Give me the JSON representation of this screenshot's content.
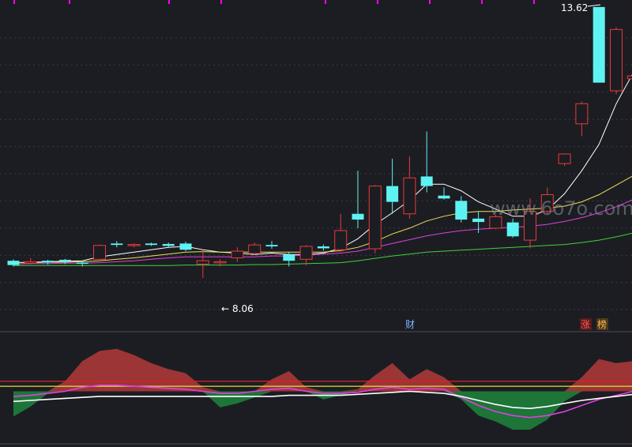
{
  "colors": {
    "background": "#1c1d22",
    "grid": "#3a3c44",
    "up": "#e83a3a",
    "down": "#5ef3f3",
    "ma5": "#ffffff",
    "ma10": "#f0e05a",
    "ma20": "#e040e0",
    "ma60": "#40d040",
    "indicator_up_fill": "#b23a3a",
    "indicator_down_fill": "#1e7a3a",
    "indicator_line_a": "#e040e0",
    "indicator_line_b": "#ffffff",
    "indicator_level_red": "#e02020",
    "indicator_level_yellow": "#e0e040",
    "markers": "#ff00ff",
    "watermark": "#8a8f9a"
  },
  "labels": {
    "high_value": "13.62",
    "low_value": "8.06",
    "low_arrow": "←",
    "event_cai": "财",
    "event_zhang": "涨",
    "event_bang": "榜",
    "watermark": "www.6o7o.com"
  },
  "chart_data": [
    {
      "type": "candlestick",
      "title": "",
      "xlabel": "",
      "ylabel": "",
      "ylim": [
        7.4,
        13.8
      ],
      "grid": true,
      "annotations": [
        {
          "text": "13.62",
          "at_index": 31,
          "kind": "high"
        },
        {
          "text": "8.06",
          "at_index": 11,
          "kind": "low"
        }
      ],
      "candles": [
        {
          "o": 8.42,
          "h": 8.45,
          "l": 8.3,
          "c": 8.33
        },
        {
          "o": 8.37,
          "h": 8.48,
          "l": 8.34,
          "c": 8.4
        },
        {
          "o": 8.42,
          "h": 8.44,
          "l": 8.34,
          "c": 8.38
        },
        {
          "o": 8.44,
          "h": 8.46,
          "l": 8.35,
          "c": 8.4
        },
        {
          "o": 8.38,
          "h": 8.4,
          "l": 8.3,
          "c": 8.37
        },
        {
          "o": 8.45,
          "h": 8.76,
          "l": 8.43,
          "c": 8.74
        },
        {
          "o": 8.78,
          "h": 8.83,
          "l": 8.7,
          "c": 8.75
        },
        {
          "o": 8.74,
          "h": 8.78,
          "l": 8.7,
          "c": 8.76
        },
        {
          "o": 8.78,
          "h": 8.8,
          "l": 8.73,
          "c": 8.75
        },
        {
          "o": 8.77,
          "h": 8.8,
          "l": 8.7,
          "c": 8.73
        },
        {
          "o": 8.78,
          "h": 8.82,
          "l": 8.62,
          "c": 8.65
        },
        {
          "o": 8.35,
          "h": 8.64,
          "l": 8.06,
          "c": 8.42
        },
        {
          "o": 8.38,
          "h": 8.45,
          "l": 8.3,
          "c": 8.4
        },
        {
          "o": 8.48,
          "h": 8.7,
          "l": 8.4,
          "c": 8.62
        },
        {
          "o": 8.57,
          "h": 8.8,
          "l": 8.55,
          "c": 8.75
        },
        {
          "o": 8.75,
          "h": 8.83,
          "l": 8.67,
          "c": 8.72
        },
        {
          "o": 8.55,
          "h": 8.6,
          "l": 8.3,
          "c": 8.42
        },
        {
          "o": 8.45,
          "h": 8.75,
          "l": 8.32,
          "c": 8.72
        },
        {
          "o": 8.72,
          "h": 8.76,
          "l": 8.63,
          "c": 8.68
        },
        {
          "o": 8.65,
          "h": 9.4,
          "l": 8.6,
          "c": 9.05
        },
        {
          "o": 9.4,
          "h": 10.3,
          "l": 9.1,
          "c": 9.28
        },
        {
          "o": 8.67,
          "h": 10.0,
          "l": 8.58,
          "c": 9.98
        },
        {
          "o": 9.98,
          "h": 10.55,
          "l": 9.4,
          "c": 9.65
        },
        {
          "o": 9.4,
          "h": 10.6,
          "l": 9.3,
          "c": 10.15
        },
        {
          "o": 10.18,
          "h": 11.12,
          "l": 9.85,
          "c": 9.98
        },
        {
          "o": 9.78,
          "h": 9.95,
          "l": 9.7,
          "c": 9.72
        },
        {
          "o": 9.67,
          "h": 9.77,
          "l": 9.22,
          "c": 9.28
        },
        {
          "o": 9.3,
          "h": 9.45,
          "l": 9.0,
          "c": 9.23
        },
        {
          "o": 9.1,
          "h": 9.38,
          "l": 9.08,
          "c": 9.34
        },
        {
          "o": 9.22,
          "h": 9.3,
          "l": 8.9,
          "c": 8.93
        },
        {
          "o": 8.85,
          "h": 9.72,
          "l": 8.68,
          "c": 9.45
        },
        {
          "o": 9.45,
          "h": 9.95,
          "l": 9.4,
          "c": 9.8
        },
        {
          "o": 10.45,
          "h": 10.66,
          "l": 10.4,
          "c": 10.65
        },
        {
          "o": 11.28,
          "h": 11.75,
          "l": 11.02,
          "c": 11.7
        },
        {
          "o": 13.72,
          "h": 13.72,
          "l": 12.14,
          "c": 12.14
        },
        {
          "o": 11.97,
          "h": 13.3,
          "l": 11.9,
          "c": 13.25
        },
        {
          "o": 12.22,
          "h": 12.3,
          "l": 12.0,
          "c": 12.28
        }
      ],
      "series": [
        {
          "name": "",
          "key": "ma5",
          "values": [
            8.38,
            8.39,
            8.4,
            8.41,
            8.42,
            8.5,
            8.55,
            8.6,
            8.65,
            8.7,
            8.72,
            8.65,
            8.6,
            8.58,
            8.55,
            8.58,
            8.55,
            8.55,
            8.58,
            8.68,
            8.88,
            9.18,
            9.42,
            9.68,
            10.02,
            10.02,
            9.88,
            9.65,
            9.5,
            9.35,
            9.35,
            9.48,
            9.82,
            10.3,
            10.85,
            11.7,
            12.35
          ]
        },
        {
          "name": "",
          "key": "ma10",
          "values": [
            8.38,
            8.38,
            8.39,
            8.39,
            8.4,
            8.42,
            8.45,
            8.48,
            8.52,
            8.56,
            8.6,
            8.61,
            8.6,
            8.6,
            8.6,
            8.6,
            8.6,
            8.6,
            8.6,
            8.63,
            8.7,
            8.82,
            8.98,
            9.1,
            9.25,
            9.35,
            9.42,
            9.45,
            9.45,
            9.48,
            9.5,
            9.52,
            9.56,
            9.65,
            9.8,
            10.0,
            10.2
          ]
        },
        {
          "name": "",
          "key": "ma20",
          "values": [
            8.35,
            8.36,
            8.36,
            8.37,
            8.37,
            8.38,
            8.4,
            8.42,
            8.45,
            8.48,
            8.5,
            8.5,
            8.5,
            8.5,
            8.5,
            8.52,
            8.52,
            8.54,
            8.56,
            8.58,
            8.62,
            8.7,
            8.78,
            8.86,
            8.94,
            9.0,
            9.05,
            9.08,
            9.1,
            9.12,
            9.14,
            9.18,
            9.24,
            9.32,
            9.42,
            9.55,
            9.7
          ]
        },
        {
          "name": "",
          "key": "ma60",
          "values": [
            8.32,
            8.32,
            8.32,
            8.32,
            8.32,
            8.32,
            8.32,
            8.32,
            8.32,
            8.32,
            8.33,
            8.33,
            8.33,
            8.33,
            8.34,
            8.34,
            8.35,
            8.36,
            8.37,
            8.38,
            8.42,
            8.47,
            8.52,
            8.56,
            8.6,
            8.62,
            8.64,
            8.66,
            8.68,
            8.7,
            8.72,
            8.74,
            8.76,
            8.8,
            8.85,
            8.92,
            9.0
          ]
        }
      ]
    },
    {
      "type": "area",
      "title": "",
      "xlabel": "",
      "ylabel": "",
      "ylim": [
        -45,
        45
      ],
      "levels": [
        {
          "key": "red",
          "value": 10
        },
        {
          "key": "yellow",
          "value": 5
        }
      ],
      "series": [
        {
          "name": "",
          "key": "indicator_main",
          "values": [
            -25,
            -15,
            -2,
            10,
            30,
            40,
            42,
            36,
            28,
            22,
            18,
            4,
            -16,
            -12,
            -6,
            12,
            20,
            4,
            -8,
            -4,
            2,
            16,
            28,
            12,
            22,
            14,
            -8,
            -24,
            -30,
            -38,
            -38,
            -28,
            -10,
            14,
            32,
            28,
            30
          ]
        },
        {
          "name": "",
          "key": "line_a",
          "values": [
            -5,
            -4,
            -2,
            0,
            4,
            6,
            6,
            5,
            4,
            3,
            2,
            0,
            -2,
            -2,
            0,
            2,
            3,
            0,
            -2,
            -2,
            -1,
            2,
            4,
            2,
            3,
            2,
            -6,
            -14,
            -20,
            -24,
            -26,
            -24,
            -20,
            -14,
            -8,
            -4,
            0
          ]
        },
        {
          "name": "",
          "key": "line_b",
          "values": [
            -10,
            -9,
            -8,
            -7,
            -6,
            -5,
            -5,
            -5,
            -5,
            -5,
            -5,
            -5,
            -5,
            -5,
            -5,
            -5,
            -4,
            -4,
            -4,
            -4,
            -3,
            -2,
            -1,
            0,
            -1,
            -2,
            -5,
            -9,
            -13,
            -16,
            -17,
            -15,
            -12,
            -9,
            -7,
            -5,
            -3
          ]
        }
      ]
    }
  ]
}
